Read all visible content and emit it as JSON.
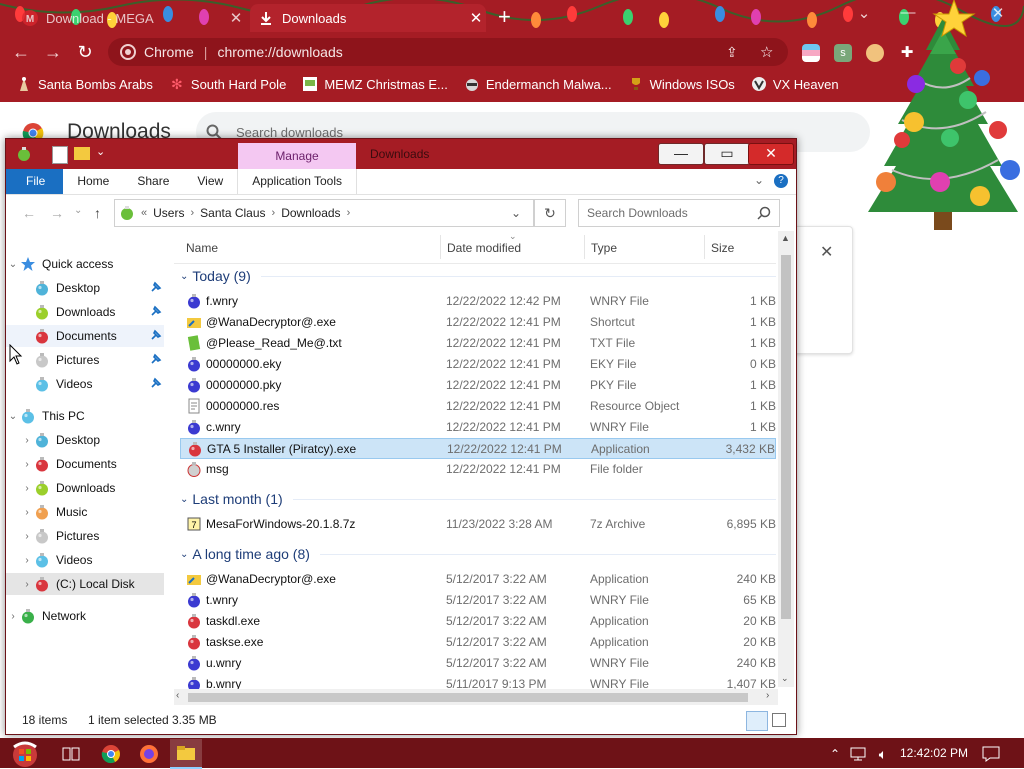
{
  "colors": {
    "chrome_bg": "#a51c24",
    "taskbar_bg": "#6e1217",
    "manage_tab_bg": "#f4c8f2",
    "file_tab_bg": "#1a6fc2",
    "selection_bg": "#cce4f7",
    "group_header": "#1e3d78"
  },
  "browser": {
    "tabs": [
      {
        "title": "Download - MEGA",
        "icon": "mega-icon"
      },
      {
        "title": "Downloads",
        "icon": "download-icon"
      }
    ],
    "omnibox": {
      "site": "Chrome",
      "url": "chrome://downloads"
    },
    "bookmarks": [
      {
        "label": "Santa Bombs Arabs",
        "icon": "santa-icon"
      },
      {
        "label": "South Hard Pole",
        "icon": "snowflake-icon"
      },
      {
        "label": "MEMZ Christmas E...",
        "icon": "memz-icon"
      },
      {
        "label": "Endermanch Malwa...",
        "icon": "raccoon-icon"
      },
      {
        "label": "Windows ISOs",
        "icon": "trophy-icon"
      },
      {
        "label": "VX Heaven",
        "icon": "vx-icon"
      }
    ]
  },
  "downloads_page": {
    "title": "Downloads",
    "search_placeholder": "Search downloads"
  },
  "explorer": {
    "title": "Downloads",
    "manage_tab": "Manage",
    "ribbon_tabs": [
      "File",
      "Home",
      "Share",
      "View",
      "Application Tools"
    ],
    "path": [
      "Users",
      "Santa Claus",
      "Downloads"
    ],
    "search_placeholder": "Search Downloads",
    "columns": {
      "name": "Name",
      "date": "Date modified",
      "type": "Type",
      "size": "Size"
    },
    "nav": {
      "quick_access": "Quick access",
      "quick_items": [
        "Desktop",
        "Downloads",
        "Documents",
        "Pictures",
        "Videos"
      ],
      "this_pc": "This PC",
      "pc_items": [
        "Desktop",
        "Documents",
        "Downloads",
        "Music",
        "Pictures",
        "Videos",
        "(C:) Local Disk"
      ],
      "network": "Network"
    },
    "groups": [
      {
        "label": "Today (9)",
        "files": [
          {
            "name": "f.wnry",
            "date": "12/22/2022 12:42 PM",
            "type": "WNRY File",
            "size": "1 KB",
            "icon": "ornament-blue"
          },
          {
            "name": "@WanaDecryptor@.exe",
            "date": "12/22/2022 12:41 PM",
            "type": "Shortcut",
            "size": "1 KB",
            "icon": "folder-shortcut"
          },
          {
            "name": "@Please_Read_Me@.txt",
            "date": "12/22/2022 12:41 PM",
            "type": "TXT File",
            "size": "1 KB",
            "icon": "green-doc"
          },
          {
            "name": "00000000.eky",
            "date": "12/22/2022 12:41 PM",
            "type": "EKY File",
            "size": "0 KB",
            "icon": "ornament-blue"
          },
          {
            "name": "00000000.pky",
            "date": "12/22/2022 12:41 PM",
            "type": "PKY File",
            "size": "1 KB",
            "icon": "ornament-blue"
          },
          {
            "name": "00000000.res",
            "date": "12/22/2022 12:41 PM",
            "type": "Resource Object",
            "size": "1 KB",
            "icon": "doc"
          },
          {
            "name": "c.wnry",
            "date": "12/22/2022 12:41 PM",
            "type": "WNRY File",
            "size": "1 KB",
            "icon": "ornament-blue"
          },
          {
            "name": "GTA 5 Installer (Piratcy).exe",
            "date": "12/22/2022 12:41 PM",
            "type": "Application",
            "size": "3,432 KB",
            "icon": "ornament-red",
            "selected": true
          },
          {
            "name": "msg",
            "date": "12/22/2022 12:41 PM",
            "type": "File folder",
            "size": "",
            "icon": "ornament-silver"
          }
        ]
      },
      {
        "label": "Last month (1)",
        "files": [
          {
            "name": "MesaForWindows-20.1.8.7z",
            "date": "11/23/2022 3:28 AM",
            "type": "7z Archive",
            "size": "6,895 KB",
            "icon": "archive"
          }
        ]
      },
      {
        "label": "A long time ago (8)",
        "files": [
          {
            "name": "@WanaDecryptor@.exe",
            "date": "5/12/2017 3:22 AM",
            "type": "Application",
            "size": "240 KB",
            "icon": "folder-shortcut"
          },
          {
            "name": "t.wnry",
            "date": "5/12/2017 3:22 AM",
            "type": "WNRY File",
            "size": "65 KB",
            "icon": "ornament-blue"
          },
          {
            "name": "taskdl.exe",
            "date": "5/12/2017 3:22 AM",
            "type": "Application",
            "size": "20 KB",
            "icon": "ornament-red"
          },
          {
            "name": "taskse.exe",
            "date": "5/12/2017 3:22 AM",
            "type": "Application",
            "size": "20 KB",
            "icon": "ornament-red"
          },
          {
            "name": "u.wnry",
            "date": "5/12/2017 3:22 AM",
            "type": "WNRY File",
            "size": "240 KB",
            "icon": "ornament-blue"
          },
          {
            "name": "b.wnry",
            "date": "5/11/2017 9:13 PM",
            "type": "WNRY File",
            "size": "1,407 KB",
            "icon": "ornament-blue"
          }
        ]
      }
    ],
    "status": {
      "items": "18 items",
      "selected": "1 item selected",
      "size": "3.35 MB"
    }
  },
  "taskbar": {
    "clock": "12:42:02 PM"
  }
}
